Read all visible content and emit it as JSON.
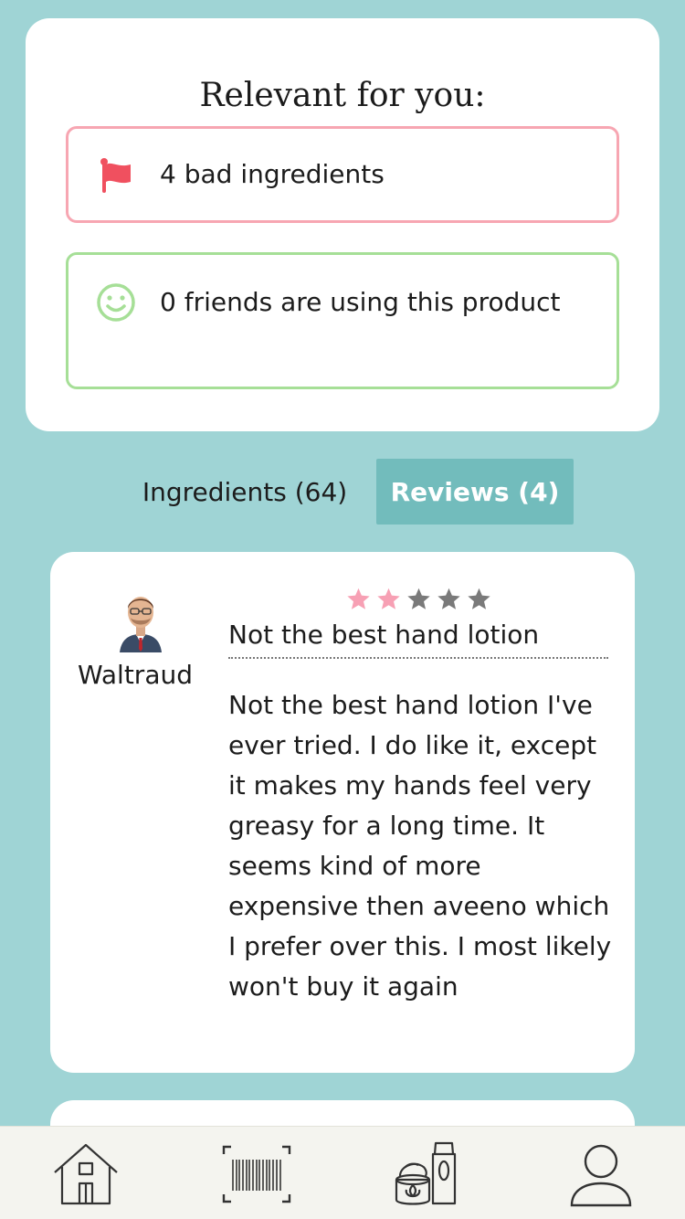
{
  "relevant": {
    "title": "Relevant for you:",
    "bad_ingredients": "4 bad ingredients",
    "friends_using": "0 friends are using this product"
  },
  "tabs": {
    "ingredients": "Ingredients (64)",
    "reviews": "Reviews (4)"
  },
  "review": {
    "reviewer": "Waltraud",
    "rating": 2,
    "max_rating": 5,
    "title": "Not the best hand lotion",
    "body": "Not the best hand lotion I've ever tried. I do like it, except it makes my hands feel very greasy for a long time. It seems kind of more expensive then aveeno which I prefer over this. I most likely won't buy it again"
  },
  "colors": {
    "background": "#9fd4d5",
    "bad_accent": "#f0505f",
    "bad_border": "#f7a6b2",
    "good_accent": "#a6df97",
    "active_tab": "#72bcbc",
    "star_filled": "#f7a0b4",
    "star_empty": "#7a7a7a"
  },
  "nav": {
    "home": "home-icon",
    "scan": "barcode-scan-icon",
    "products": "products-icon",
    "profile": "user-icon"
  }
}
